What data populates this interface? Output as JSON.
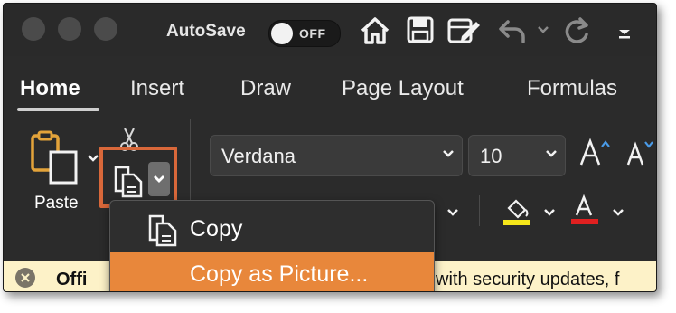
{
  "titlebar": {
    "autosave_label": "AutoSave",
    "toggle_state": "OFF"
  },
  "tabs": [
    "Home",
    "Insert",
    "Draw",
    "Page Layout",
    "Formulas"
  ],
  "active_tab": "Home",
  "clipboard": {
    "paste_label": "Paste"
  },
  "font": {
    "name": "Verdana",
    "size": "10"
  },
  "menu": {
    "items": [
      {
        "label": "Copy"
      },
      {
        "label": "Copy as Picture..."
      }
    ],
    "selected_index": 1
  },
  "infobar": {
    "text_left": "Offi",
    "text_right": "with security updates, f"
  },
  "colors": {
    "highlight_frame": "#d9683a",
    "menu_selected": "#e8873b",
    "highlight_swatch": "#f5e61a",
    "font_color_swatch": "#e02020",
    "infobar_bg": "#fdf2c8"
  }
}
